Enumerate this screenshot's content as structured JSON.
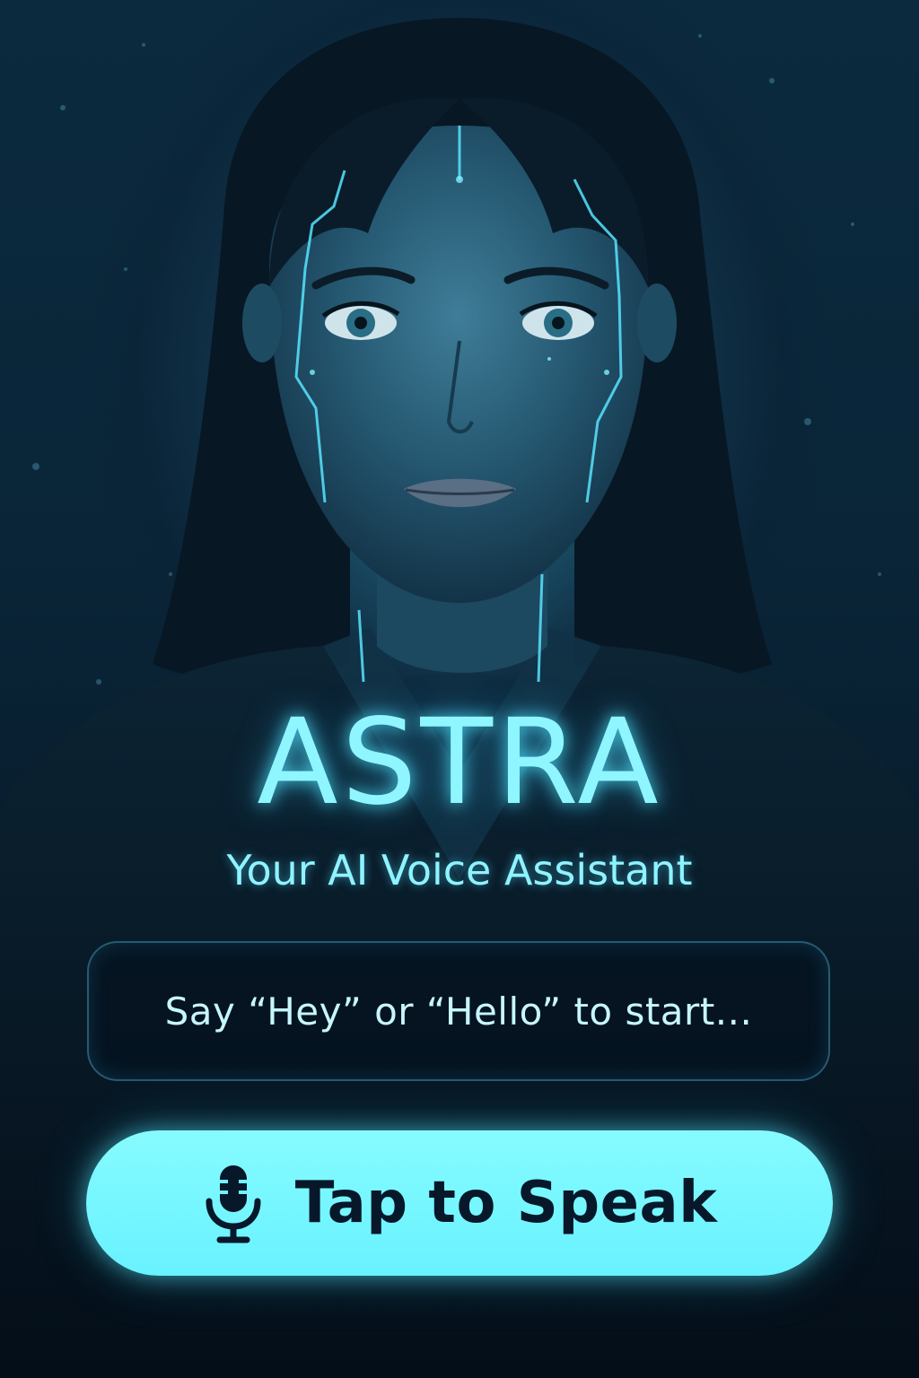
{
  "app": {
    "title": "ASTRA",
    "subtitle": "Your AI Voice Assistant"
  },
  "prompt": {
    "text": "Say “Hey” or “Hello” to start..."
  },
  "speak_button": {
    "label": "Tap to Speak",
    "icon": "microphone-icon"
  },
  "colors": {
    "accent": "#6ff4ff",
    "background": "#041422",
    "button_text": "#06182a"
  }
}
